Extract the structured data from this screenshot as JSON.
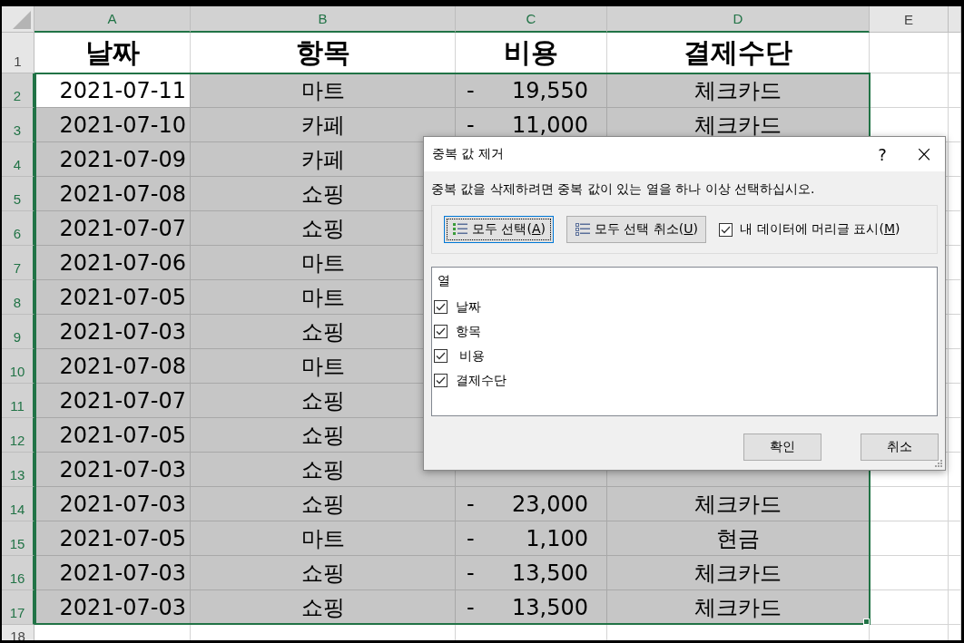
{
  "sheet": {
    "columns": [
      {
        "label": "A",
        "selected": true
      },
      {
        "label": "B",
        "selected": true
      },
      {
        "label": "C",
        "selected": true
      },
      {
        "label": "D",
        "selected": true
      },
      {
        "label": "E",
        "selected": false
      }
    ],
    "header_row": {
      "number": "1",
      "selected": false,
      "cells": [
        "날짜",
        "항목",
        "비용",
        "결제수단"
      ]
    },
    "rows": [
      {
        "number": "2",
        "selected": true,
        "active": true,
        "date": "2021-07-11",
        "item": "마트",
        "sign": "-",
        "amount": "19,550",
        "payment": "체크카드"
      },
      {
        "number": "3",
        "selected": true,
        "active": false,
        "date": "2021-07-10",
        "item": "카페",
        "sign": "-",
        "amount": "11,000",
        "payment": "체크카드"
      },
      {
        "number": "4",
        "selected": true,
        "active": false,
        "date": "2021-07-09",
        "item": "카페"
      },
      {
        "number": "5",
        "selected": true,
        "active": false,
        "date": "2021-07-08",
        "item": "쇼핑"
      },
      {
        "number": "6",
        "selected": true,
        "active": false,
        "date": "2021-07-07",
        "item": "쇼핑"
      },
      {
        "number": "7",
        "selected": true,
        "active": false,
        "date": "2021-07-06",
        "item": "마트"
      },
      {
        "number": "8",
        "selected": true,
        "active": false,
        "date": "2021-07-05",
        "item": "마트"
      },
      {
        "number": "9",
        "selected": true,
        "active": false,
        "date": "2021-07-03",
        "item": "쇼핑"
      },
      {
        "number": "10",
        "selected": true,
        "active": false,
        "date": "2021-07-08",
        "item": "마트"
      },
      {
        "number": "11",
        "selected": true,
        "active": false,
        "date": "2021-07-07",
        "item": "쇼핑"
      },
      {
        "number": "12",
        "selected": true,
        "active": false,
        "date": "2021-07-05",
        "item": "쇼핑"
      },
      {
        "number": "13",
        "selected": true,
        "active": false,
        "date": "2021-07-03",
        "item": "쇼핑"
      },
      {
        "number": "14",
        "selected": true,
        "active": false,
        "date": "2021-07-03",
        "item": "쇼핑",
        "sign": "-",
        "amount": "23,000",
        "payment": "체크카드"
      },
      {
        "number": "15",
        "selected": true,
        "active": false,
        "date": "2021-07-05",
        "item": "마트",
        "sign": "-",
        "amount": "1,100",
        "payment": "현금"
      },
      {
        "number": "16",
        "selected": true,
        "active": false,
        "date": "2021-07-03",
        "item": "쇼핑",
        "sign": "-",
        "amount": "13,500",
        "payment": "체크카드"
      },
      {
        "number": "17",
        "selected": true,
        "active": false,
        "date": "2021-07-03",
        "item": "쇼핑",
        "sign": "-",
        "amount": "13,500",
        "payment": "체크카드"
      }
    ],
    "last_row": {
      "number": "18",
      "selected": false
    }
  },
  "dialog": {
    "title": "중복 값 제거",
    "help": "?",
    "close": "×",
    "instruction": "중복 값을 삭제하려면 중복 값이 있는 열을 하나 이상 선택하십시오.",
    "select_all": {
      "label": "모두 선택(A)",
      "focused": true
    },
    "unselect_all": {
      "label": "모두 선택 취소(U)",
      "focused": false
    },
    "headers_checkbox": {
      "label": "내 데이터에 머리글 표시(M)",
      "checked": true
    },
    "list_header": "열",
    "columns": [
      {
        "label": "날짜",
        "checked": true
      },
      {
        "label": "항목",
        "checked": true
      },
      {
        "label": " 비용",
        "checked": true
      },
      {
        "label": "결제수단",
        "checked": true
      }
    ],
    "buttons": [
      "확인",
      "취소"
    ]
  }
}
